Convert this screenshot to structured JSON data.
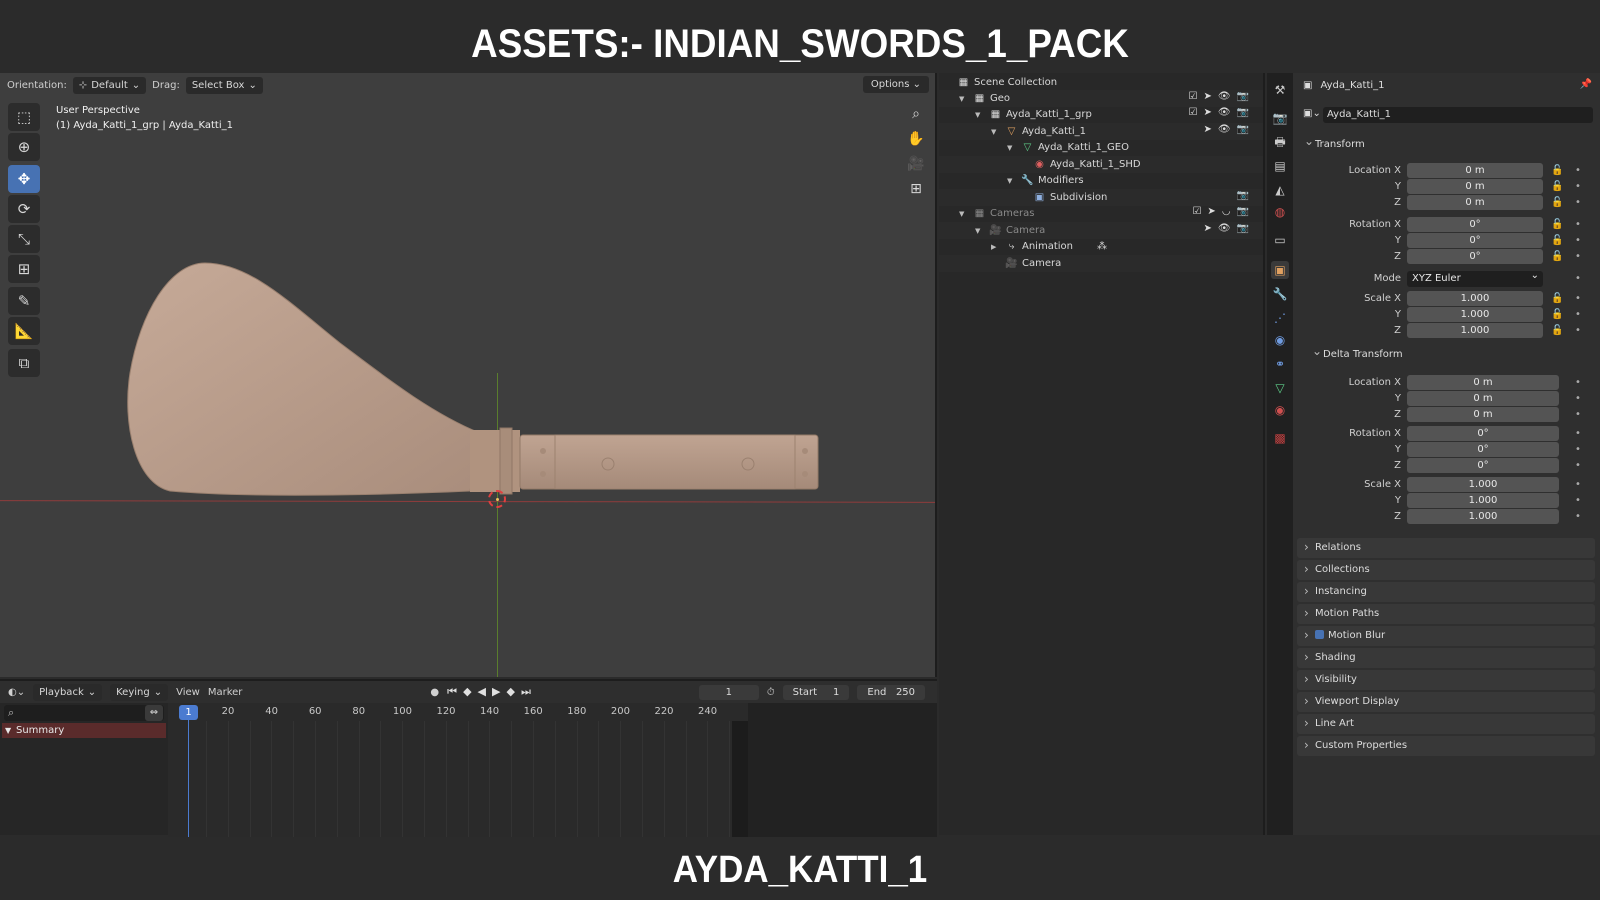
{
  "banner": {
    "top": "ASSETS:- INDIAN_SWORDS_1_PACK",
    "bottom": "AYDA_KATTI_1"
  },
  "viewport": {
    "orientation_label": "Orientation:",
    "orientation_value": "Default",
    "drag_label": "Drag:",
    "drag_value": "Select Box",
    "options": "Options",
    "view_name": "User Perspective",
    "object_info": "(1) Ayda_Katti_1_grp | Ayda_Katti_1"
  },
  "timeline": {
    "playback": "Playback",
    "keying": "Keying",
    "view": "View",
    "marker": "Marker",
    "current_frame": "1",
    "start_label": "Start",
    "start_value": "1",
    "end_label": "End",
    "end_value": "250",
    "summary": "Summary",
    "ticks": [
      "20",
      "40",
      "60",
      "80",
      "100",
      "120",
      "140",
      "160",
      "180",
      "200",
      "220",
      "240"
    ]
  },
  "outliner": {
    "scene_collection": "Scene Collection",
    "items": [
      {
        "label": "Geo"
      },
      {
        "label": "Ayda_Katti_1_grp"
      },
      {
        "label": "Ayda_Katti_1"
      },
      {
        "label": "Ayda_Katti_1_GEO"
      },
      {
        "label": "Ayda_Katti_1_SHD"
      },
      {
        "label": "Modifiers"
      },
      {
        "label": "Subdivision"
      },
      {
        "label": "Cameras"
      },
      {
        "label": "Camera"
      },
      {
        "label": "Animation"
      },
      {
        "label": "Camera"
      }
    ]
  },
  "properties": {
    "object_name": "Ayda_Katti_1",
    "name_field": "Ayda_Katti_1",
    "transform": {
      "title": "Transform",
      "location_x_label": "Location X",
      "location_x": "0 m",
      "location_y_label": "Y",
      "location_y": "0 m",
      "location_z_label": "Z",
      "location_z": "0 m",
      "rotation_x_label": "Rotation X",
      "rotation_x": "0°",
      "rotation_y_label": "Y",
      "rotation_y": "0°",
      "rotation_z_label": "Z",
      "rotation_z": "0°",
      "mode_label": "Mode",
      "mode": "XYZ Euler",
      "scale_x_label": "Scale X",
      "scale_x": "1.000",
      "scale_y_label": "Y",
      "scale_y": "1.000",
      "scale_z_label": "Z",
      "scale_z": "1.000"
    },
    "delta": {
      "title": "Delta Transform",
      "location_x_label": "Location X",
      "location_x": "0 m",
      "location_y_label": "Y",
      "location_y": "0 m",
      "location_z_label": "Z",
      "location_z": "0 m",
      "rotation_x_label": "Rotation X",
      "rotation_x": "0°",
      "rotation_y_label": "Y",
      "rotation_y": "0°",
      "rotation_z_label": "Z",
      "rotation_z": "0°",
      "scale_x_label": "Scale X",
      "scale_x": "1.000",
      "scale_y_label": "Y",
      "scale_y": "1.000",
      "scale_z_label": "Z",
      "scale_z": "1.000"
    },
    "sections": [
      "Relations",
      "Collections",
      "Instancing",
      "Motion Paths",
      "Motion Blur",
      "Shading",
      "Visibility",
      "Viewport Display",
      "Line Art",
      "Custom Properties"
    ]
  },
  "colors": {
    "accent": "#4772b3",
    "sword": "#b89c8a",
    "summary": "#5a2b2b"
  }
}
